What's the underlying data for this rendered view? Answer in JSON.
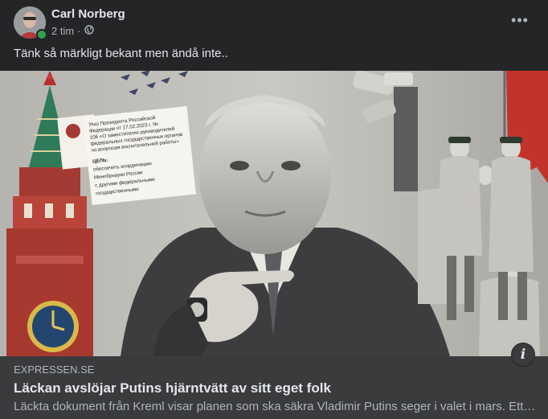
{
  "post": {
    "author": "Carl Norberg",
    "time": "2 tim",
    "separator": "·",
    "privacy_icon": "globe-icon",
    "more_label": "•••",
    "text": "Tänk så märkligt bekant men ändå inte.."
  },
  "link_preview": {
    "domain": "EXPRESSEN.SE",
    "title": "Läckan avslöjar Putins hjärntvätt av sitt eget folk",
    "description": "Läckta dokument från Kreml visar planen som ska säkra Vladimir Putins seger i valet i mars. Ett system för att påverka medborgarna, från förskola till pension.",
    "info_label": "i"
  },
  "image": {
    "document_lines": [
      "Указ Президента Российской",
      "Федерации от 17.02.2023 г. №",
      "106 «О заместителях руководителей",
      "федеральных государственных органов",
      "по вопросам воспитательной работы»",
      "ЦЕЛЬ:",
      "обеспечить координацию",
      "Минобрнауки России",
      "с другими федеральными",
      "государственными"
    ]
  },
  "colors": {
    "background": "#242526",
    "card": "#3a3b3c",
    "text_primary": "#e4e6eb",
    "text_secondary": "#b0b3b8",
    "online": "#31a24c"
  }
}
